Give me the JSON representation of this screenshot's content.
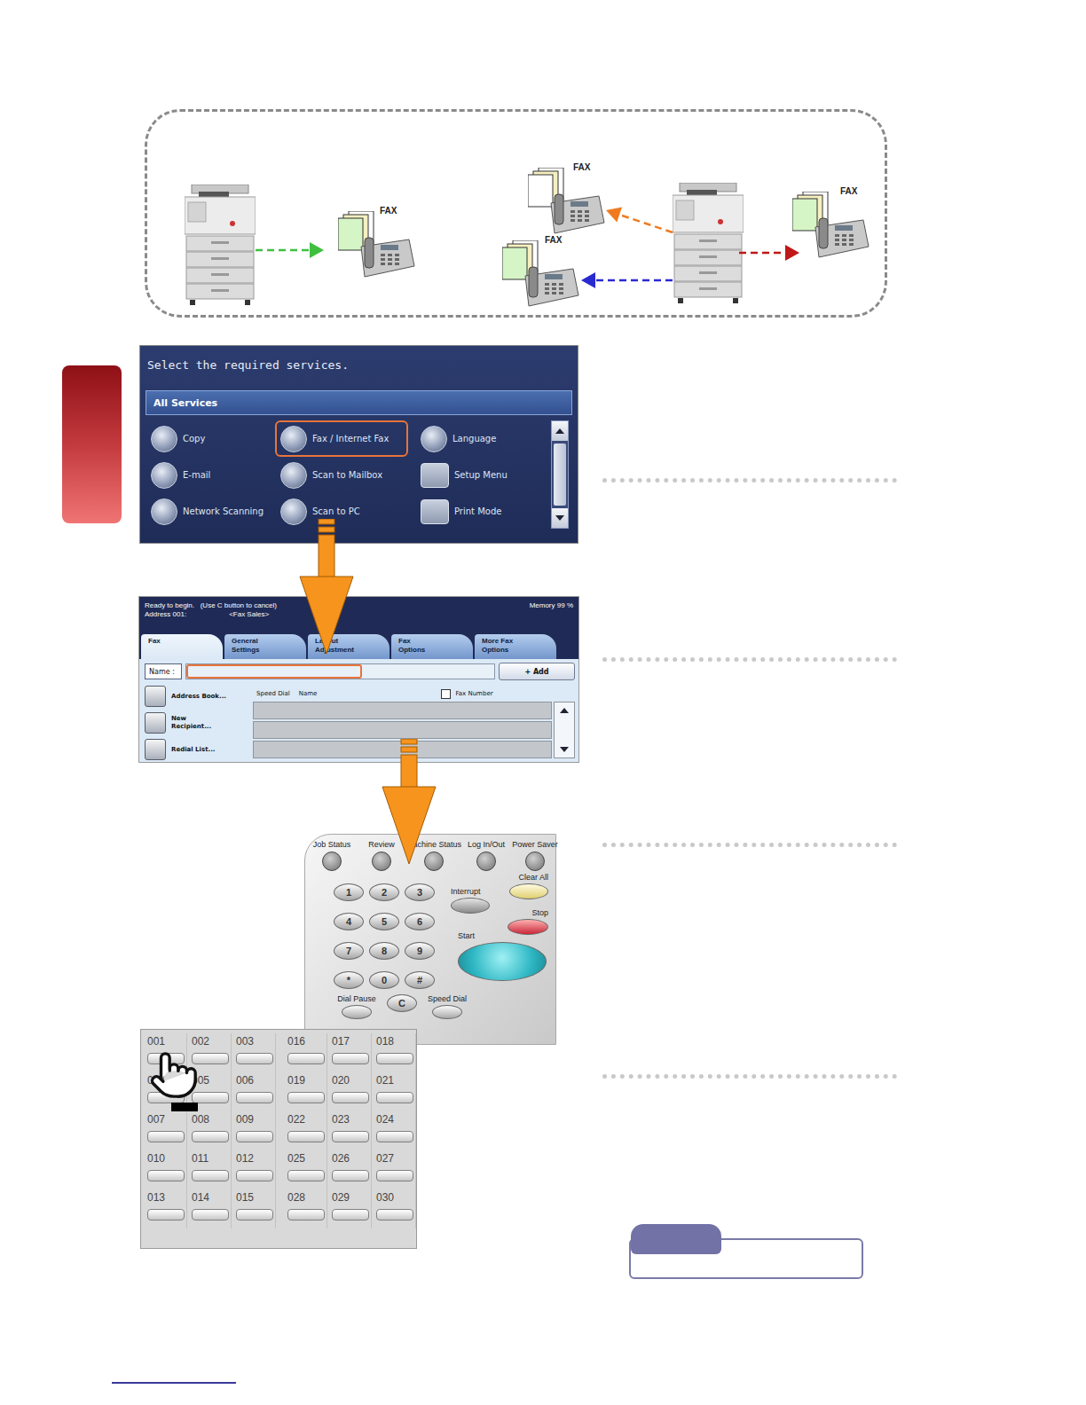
{
  "diagram": {
    "faxes": [
      {
        "label": "FAX",
        "paper": "#d6f5c6"
      },
      {
        "label": "FAX",
        "paper": "#ffffff"
      },
      {
        "label": "FAX",
        "paper": "#d6f5c6"
      },
      {
        "label": "FAX",
        "paper": "#d6f5c6"
      }
    ],
    "arrows": [
      {
        "color": "#3fbf3f"
      },
      {
        "color": "#f07a20"
      },
      {
        "color": "#2a2ad0"
      },
      {
        "color": "#c01818"
      }
    ]
  },
  "services_screen": {
    "prompt": "Select the required services.",
    "group": "All Services",
    "services": [
      {
        "label": "Copy",
        "kind": "round",
        "selected": false
      },
      {
        "label": "Fax / Internet Fax",
        "kind": "round",
        "selected": true
      },
      {
        "label": "Language",
        "kind": "round",
        "selected": false
      },
      {
        "label": "E-mail",
        "kind": "round",
        "selected": false
      },
      {
        "label": "Scan to Mailbox",
        "kind": "round",
        "selected": false
      },
      {
        "label": "Setup Menu",
        "kind": "square",
        "selected": false
      },
      {
        "label": "Network Scanning",
        "kind": "round",
        "selected": false
      },
      {
        "label": "Scan to PC",
        "kind": "round",
        "selected": false
      },
      {
        "label": "Print Mode",
        "kind": "square",
        "selected": false
      }
    ]
  },
  "fax_screen": {
    "status": "Ready to begin.   (Use C button to cancel)",
    "address_label": "Address 001:",
    "address_name": "<Fax Sales>",
    "memory": "Memory  99 %",
    "tabs": [
      {
        "lines": [
          "Fax"
        ],
        "selected": true
      },
      {
        "lines": [
          "General",
          "Settings"
        ],
        "selected": false
      },
      {
        "lines": [
          "Layout",
          "Adjustment"
        ],
        "selected": false
      },
      {
        "lines": [
          "Fax",
          "Options"
        ],
        "selected": false
      },
      {
        "lines": [
          "More Fax",
          "Options"
        ],
        "selected": false
      }
    ],
    "name_label": "Name :",
    "add_button": "+ Add",
    "side_buttons": [
      {
        "lines": [
          "Address Book..."
        ]
      },
      {
        "lines": [
          "New",
          "Recipient..."
        ]
      },
      {
        "lines": [
          "Redial List..."
        ]
      }
    ],
    "columns": [
      "Speed Dial",
      "Name"
    ],
    "fax_number": {
      "label": "Fax Number",
      "checked": false
    },
    "rows": [
      {
        "speed_dial": "",
        "name": ""
      },
      {
        "speed_dial": "",
        "name": ""
      },
      {
        "speed_dial": "",
        "name": ""
      }
    ]
  },
  "control_panel": {
    "top_buttons": [
      "Job Status",
      "Review",
      "Machine Status",
      "Log In/Out",
      "Power Saver"
    ],
    "keys": [
      "1",
      "2",
      "3",
      "4",
      "5",
      "6",
      "7",
      "8",
      "9",
      "*",
      "0",
      "#"
    ],
    "clear_all": "Clear All",
    "interrupt": "Interrupt",
    "stop": "Stop",
    "start": "Start",
    "bottom_keys": [
      {
        "label": "Dial Pause",
        "kind": "labeled"
      },
      {
        "label": "C",
        "kind": "key"
      },
      {
        "label": "Speed Dial",
        "kind": "labeled"
      }
    ]
  },
  "speed_dial_pad": {
    "groups": [
      [
        "001",
        "002",
        "003",
        "004",
        "005",
        "006",
        "007",
        "008",
        "009",
        "010",
        "011",
        "012",
        "013",
        "014",
        "015"
      ],
      [
        "016",
        "017",
        "018",
        "019",
        "020",
        "021",
        "022",
        "023",
        "024",
        "025",
        "026",
        "027",
        "028",
        "029",
        "030"
      ]
    ]
  }
}
